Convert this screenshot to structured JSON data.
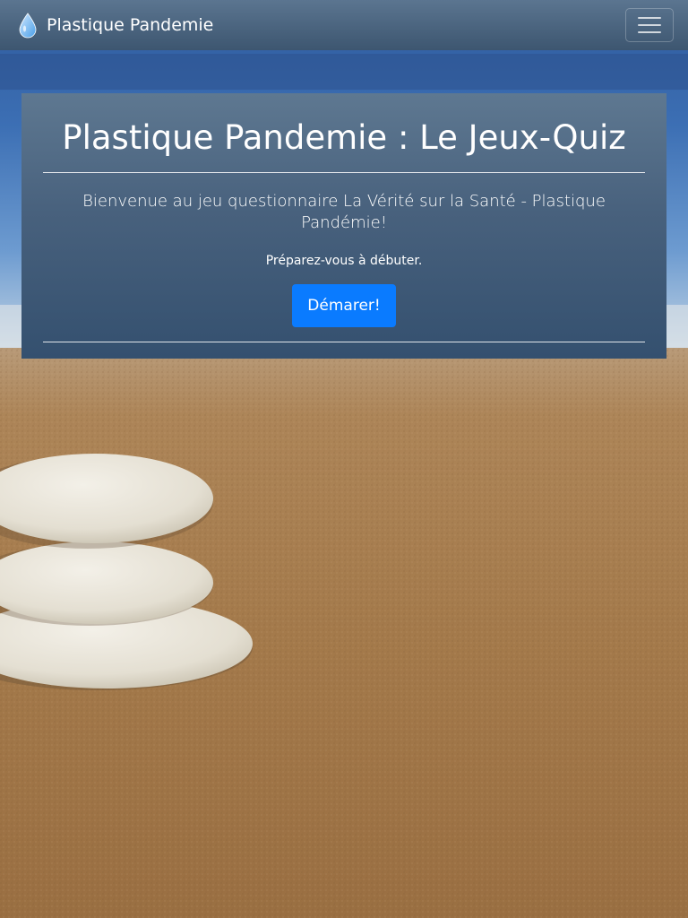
{
  "navbar": {
    "brand_text": "Plastique Pandemie",
    "brand_icon": "water-drop-icon",
    "menu_icon": "hamburger-menu-icon"
  },
  "hero": {
    "title": "Plastique Pandemie : Le Jeux-Quiz",
    "lead": "Bienvenue au jeu questionnaire La Vérité sur la Santé - Plastique Pandémie!",
    "prepare_text": "Préparez-vous à débuter.",
    "start_button_label": "Démarer!"
  },
  "colors": {
    "navbar": "#4a6580",
    "card": "#48617d",
    "button": "#0a7bff",
    "text": "#ffffff"
  }
}
